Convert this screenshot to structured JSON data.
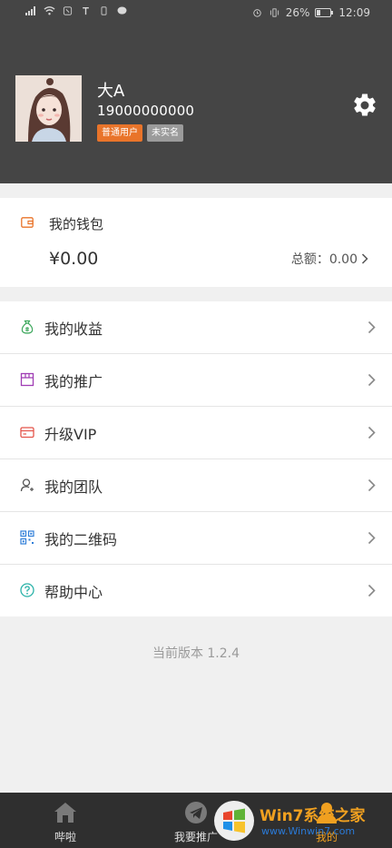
{
  "status_bar": {
    "battery": "26%",
    "time": "12:09"
  },
  "profile": {
    "name": "大A",
    "phone": "19000000000",
    "badge_level": "普通用户",
    "badge_verification": "未实名"
  },
  "wallet": {
    "title": "我的钱包",
    "balance": "¥0.00",
    "total_label": "总额：0.00"
  },
  "menu": {
    "items": [
      {
        "label": "我的收益",
        "icon": "money-bag-icon"
      },
      {
        "label": "我的推广",
        "icon": "promo-box-icon"
      },
      {
        "label": "升级VIP",
        "icon": "card-icon"
      },
      {
        "label": "我的团队",
        "icon": "team-icon"
      },
      {
        "label": "我的二维码",
        "icon": "qrcode-icon"
      },
      {
        "label": "帮助中心",
        "icon": "help-icon"
      }
    ]
  },
  "version": "当前版本 1.2.4",
  "tabbar": {
    "tabs": [
      {
        "label": "哔啦",
        "icon": "home-icon"
      },
      {
        "label": "我要推广",
        "icon": "paper-plane-icon"
      },
      {
        "label": "我的",
        "icon": "person-icon",
        "active": true
      }
    ]
  },
  "watermark": {
    "text": "Win7系统之家",
    "url": "www.Winwin7.com"
  },
  "colors": {
    "header_bg": "#454545",
    "badge_orange": "#e9742a",
    "badge_gray": "#9b9b9b",
    "tabbar_bg": "#2f2f2f"
  }
}
